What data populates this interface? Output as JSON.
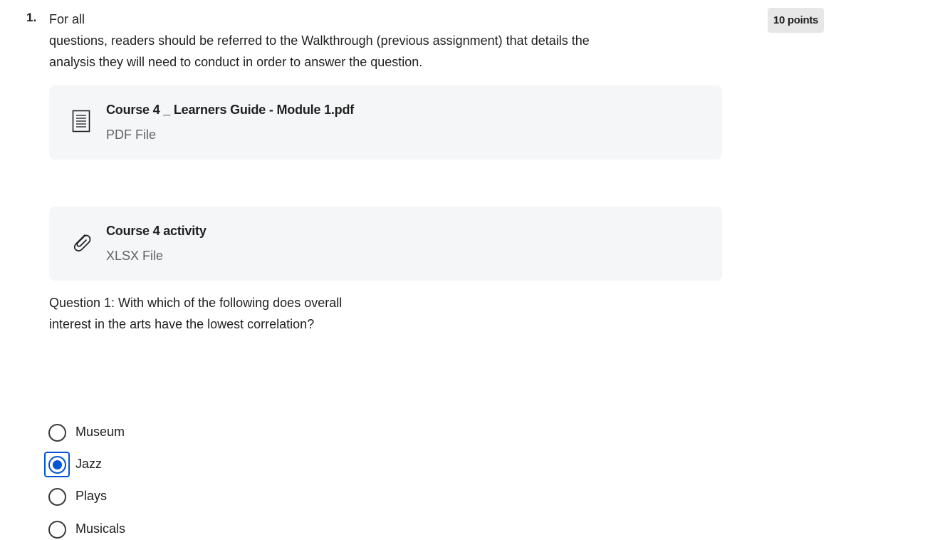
{
  "question": {
    "number": "1.",
    "points": "10 points",
    "intro_lines": [
      "For all",
      "questions, readers should be referred to the Walkthrough (previous assignment) that details the",
      "analysis they will need to conduct in order to answer the question."
    ],
    "prompt_lines": [
      "Question 1: With which of the following does overall",
      "interest in the arts have the lowest correlation?"
    ]
  },
  "attachments": [
    {
      "title": "Course 4 _ Learners Guide - Module 1.pdf",
      "type": "PDF File",
      "icon": "document-icon"
    },
    {
      "title": "Course 4 activity",
      "type": "XLSX File",
      "icon": "paperclip-icon"
    }
  ],
  "options": [
    {
      "label": "Museum",
      "selected": false
    },
    {
      "label": "Jazz",
      "selected": true
    },
    {
      "label": "Plays",
      "selected": false
    },
    {
      "label": "Musicals",
      "selected": false
    }
  ],
  "colors": {
    "accent": "#0056d2",
    "attachment_bg": "#f5f6f7",
    "badge_bg": "#e7e7e7",
    "secondary_text": "#636363"
  }
}
